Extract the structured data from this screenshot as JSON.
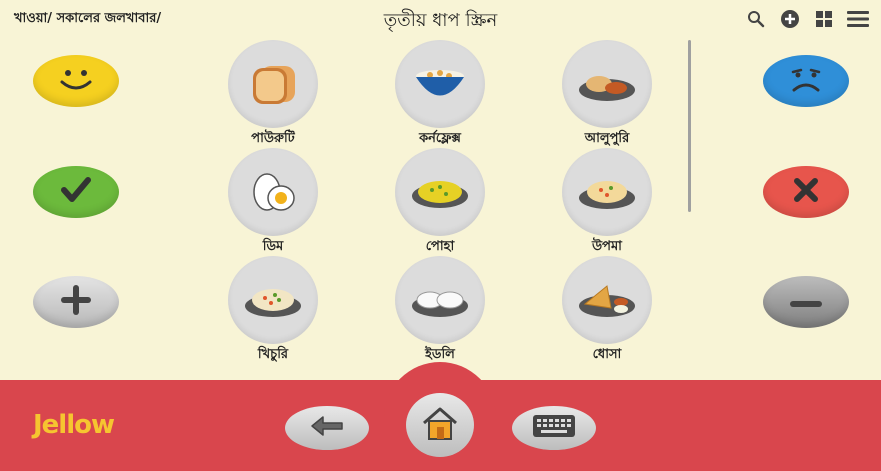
{
  "header": {
    "breadcrumb": "খাওয়া/ সকালের জলখাবার/",
    "title": "তৃতীয় ধাপ স্ক্রিন",
    "icons": [
      "search-icon",
      "add-circle-icon",
      "grid-view-icon",
      "menu-icon"
    ]
  },
  "left_buttons": [
    {
      "name": "like",
      "icon": "smiley-happy-icon",
      "color": "#f5d020"
    },
    {
      "name": "yes",
      "icon": "check-icon",
      "color": "#6cba3c"
    },
    {
      "name": "more",
      "icon": "plus-icon",
      "color": "#c8c8c8"
    }
  ],
  "right_buttons": [
    {
      "name": "dislike",
      "icon": "smiley-sad-icon",
      "color": "#2f8fd8"
    },
    {
      "name": "no",
      "icon": "cross-icon",
      "color": "#e7554c"
    },
    {
      "name": "less",
      "icon": "minus-icon",
      "color": "#9a9a9a"
    }
  ],
  "items": [
    {
      "label": "পাউরুটি",
      "icon": "bread-icon"
    },
    {
      "label": "কর্নফ্লেক্স",
      "icon": "cornflakes-bowl-icon"
    },
    {
      "label": "আলুপুরি",
      "icon": "aloo-puri-icon"
    },
    {
      "label": "ডিম",
      "icon": "egg-icon"
    },
    {
      "label": "পোহা",
      "icon": "poha-icon"
    },
    {
      "label": "উপমা",
      "icon": "upma-icon"
    },
    {
      "label": "খিচুরি",
      "icon": "khichdi-icon"
    },
    {
      "label": "ইডলি",
      "icon": "idli-icon"
    },
    {
      "label": "ধোসা",
      "icon": "dosa-icon"
    }
  ],
  "footer": {
    "logo": "Jellow",
    "back_icon": "back-arrow-icon",
    "home_icon": "home-icon",
    "keyboard_icon": "keyboard-icon"
  }
}
